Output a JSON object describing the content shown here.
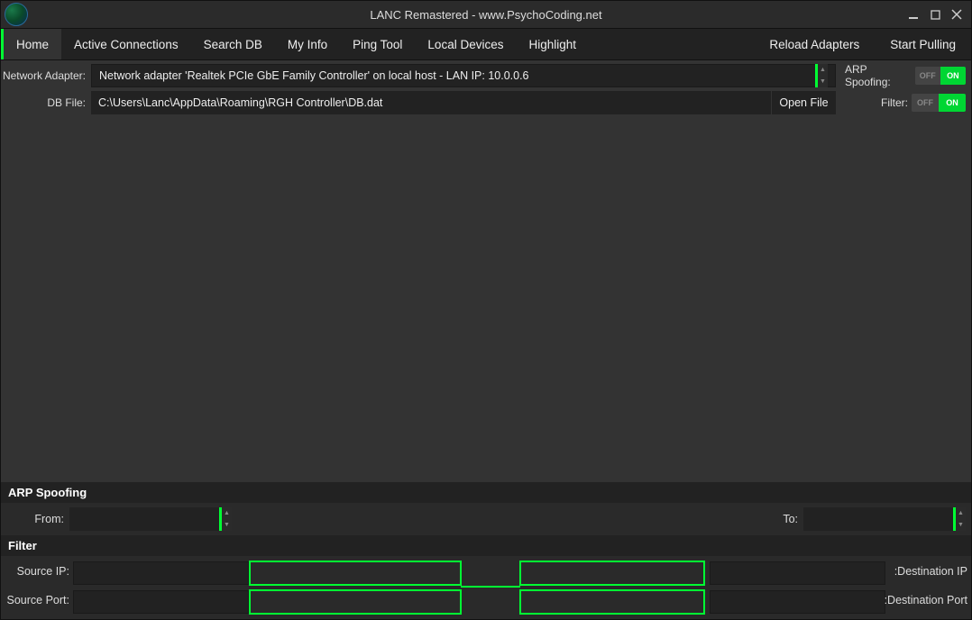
{
  "title": "LANC Remastered - www.PsychoCoding.net",
  "tabs": [
    "Home",
    "Active Connections",
    "Search DB",
    "My Info",
    "Ping Tool",
    "Local Devices",
    "Highlight"
  ],
  "active_tab_index": 0,
  "actions": {
    "reload": "Reload Adapters",
    "start_pulling": "Start Pulling"
  },
  "adapter": {
    "label": "Network Adapter:",
    "value": "Network adapter 'Realtek PCIe GbE Family Controller' on local host - LAN IP: 10.0.0.6"
  },
  "dbfile": {
    "label": "DB File:",
    "value": "C:\\Users\\Lanc\\AppData\\Roaming\\RGH Controller\\DB.dat",
    "open_label": "Open File"
  },
  "toggles": {
    "arp": {
      "label": "ARP Spoofing:",
      "off": "OFF",
      "on": "ON"
    },
    "filter": {
      "label": "Filter:",
      "off": "OFF",
      "on": "ON"
    }
  },
  "sections": {
    "arp": {
      "title": "ARP Spoofing",
      "from_label": "From:",
      "to_label": "To:"
    },
    "filter": {
      "title": "Filter",
      "source_ip": "Source IP:",
      "source_port": "Source Port:",
      "dest_ip": ":Destination IP",
      "dest_port": ":Destination Port"
    }
  }
}
